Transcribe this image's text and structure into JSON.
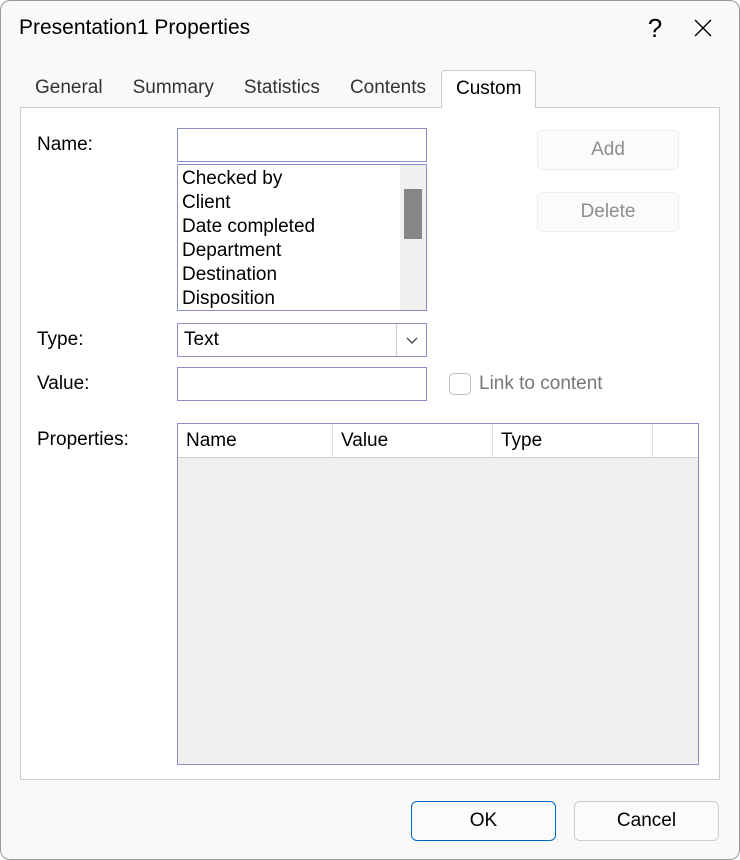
{
  "title": "Presentation1 Properties",
  "tabs": {
    "general": "General",
    "summary": "Summary",
    "statistics": "Statistics",
    "contents": "Contents",
    "custom": "Custom"
  },
  "labels": {
    "name": "Name:",
    "type": "Type:",
    "value": "Value:",
    "properties": "Properties:",
    "link_to_content": "Link to content"
  },
  "fields": {
    "name_value": "",
    "type_selected": "Text",
    "value_value": ""
  },
  "suggestions": [
    "Checked by",
    "Client",
    "Date completed",
    "Department",
    "Destination",
    "Disposition"
  ],
  "buttons": {
    "add": "Add",
    "delete": "Delete",
    "ok": "OK",
    "cancel": "Cancel"
  },
  "properties_table": {
    "headers": {
      "name": "Name",
      "value": "Value",
      "type": "Type"
    },
    "rows": []
  }
}
